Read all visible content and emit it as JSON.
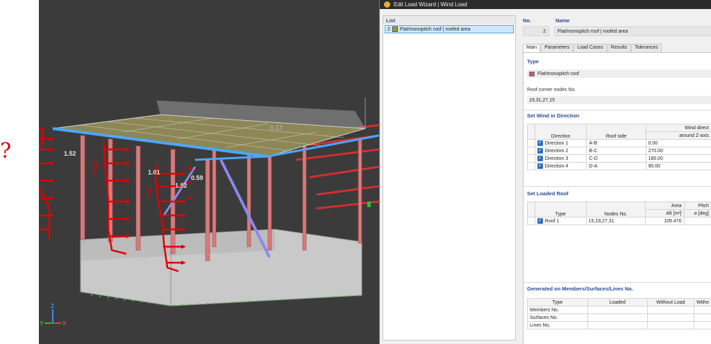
{
  "viewport": {
    "labels": [
      "1.52",
      "1.01",
      "1.52",
      "0.59",
      "0.17"
    ],
    "question_mark": "?",
    "axes": {
      "z": "Z",
      "y": "Y",
      "x": "X"
    }
  },
  "dialog": {
    "title": "Edit Load Wizard | Wind Load",
    "list": {
      "header": "List",
      "items": [
        {
          "no": "2",
          "label": "Flat/monopitch roof | roofed area"
        }
      ]
    },
    "no_label": "No.",
    "no_value": "2",
    "name_label": "Name",
    "name_value": "Flat/monopitch roof | roofed area",
    "tabs": [
      "Main",
      "Parameters",
      "Load Cases",
      "Results",
      "Tolerances"
    ],
    "type_section": {
      "title": "Type",
      "value": "Flat/monopitch roof"
    },
    "roof_nodes": {
      "label": "Roof corner nodes No.",
      "value": "19,31,27,15"
    },
    "wind_direction": {
      "title": "Set Wind in Direction",
      "col_direction": "Direction",
      "col_roof_side": "Roof side",
      "col_wind_dir_line1": "Wind direct",
      "col_wind_dir_line2": "around Z-axis",
      "rows": [
        {
          "direction": "Direction 1",
          "roof_side": "A-B",
          "angle": "0.00"
        },
        {
          "direction": "Direction 2",
          "roof_side": "B-C",
          "angle": "270.00"
        },
        {
          "direction": "Direction 3",
          "roof_side": "C-D",
          "angle": "180.00"
        },
        {
          "direction": "Direction 4",
          "roof_side": "D-A",
          "angle": "90.00"
        }
      ]
    },
    "loaded_roof": {
      "title": "Set Loaded Roof",
      "col_type": "Type",
      "col_nodes": "Nodes No.",
      "col_area_line1": "Area",
      "col_area_line2": "Aft [m²]",
      "col_pitch_line1": "Pitch",
      "col_pitch_line2": "α [deg]",
      "rows": [
        {
          "type": "Roof 1",
          "nodes": "15,19,27,31",
          "area": "105.470"
        }
      ]
    },
    "generated": {
      "title": "Generated on Members/Surfaces/Lines No.",
      "col_type": "Type",
      "col_loaded": "Loaded",
      "col_without_load": "Without Load",
      "col_witho": "Witho",
      "rows": [
        "Members No.",
        "Surfaces No.",
        "Lines No."
      ]
    }
  },
  "colors": {
    "viewport_bg": "#3b3b3b",
    "accent_blue": "#2b4c8c",
    "sketch_red": "#e00000"
  }
}
